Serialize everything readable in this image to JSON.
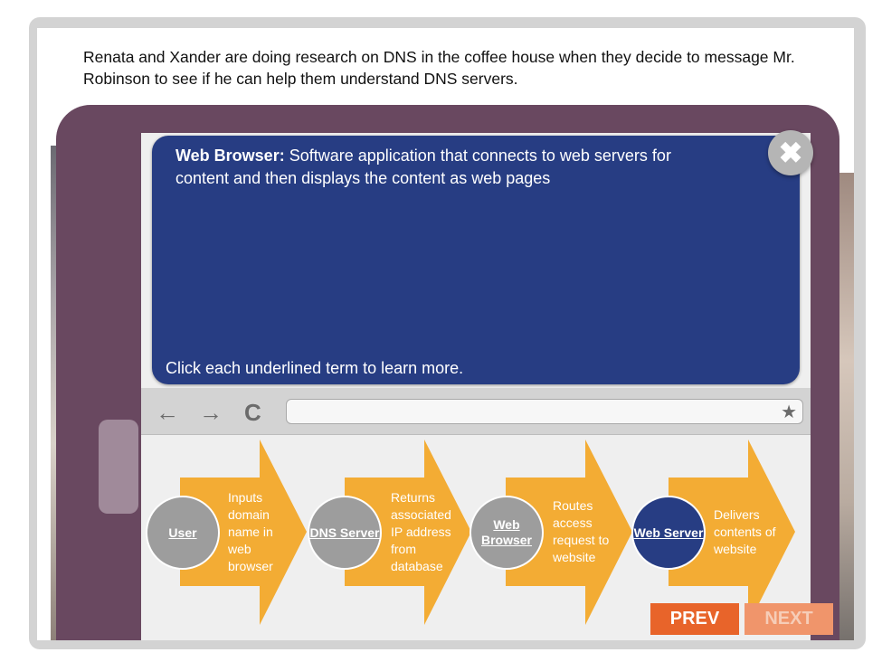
{
  "intro_text": "Renata and Xander are doing research on DNS in the coffee house when they decide to message Mr. Robinson to see if he can help them understand DNS servers.",
  "definition": {
    "term": "Web Browser:",
    "text": "Software application that connects to web servers for content and then displays the content as web pages"
  },
  "instruction": "Click each underlined term to learn more.",
  "close_symbol": "✖",
  "browser_toolbar": {
    "back": "←",
    "forward": "→",
    "reload": "C",
    "bookmark": "★"
  },
  "steps": [
    {
      "term": "User",
      "description": "Inputs domain name in web browser"
    },
    {
      "term": "DNS Server",
      "description": "Returns associated IP address from database"
    },
    {
      "term": "Web Browser",
      "description": "Routes access request to website"
    },
    {
      "term": "Web Server",
      "description": "Delivers contents of website"
    }
  ],
  "buttons": {
    "prev": "PREV",
    "next": "NEXT"
  },
  "colors": {
    "tablet": "#694860",
    "panel_blue": "#273d83",
    "arrow": "#f3ac34",
    "prev": "#e8642a",
    "next_disabled": "#f0956b"
  }
}
